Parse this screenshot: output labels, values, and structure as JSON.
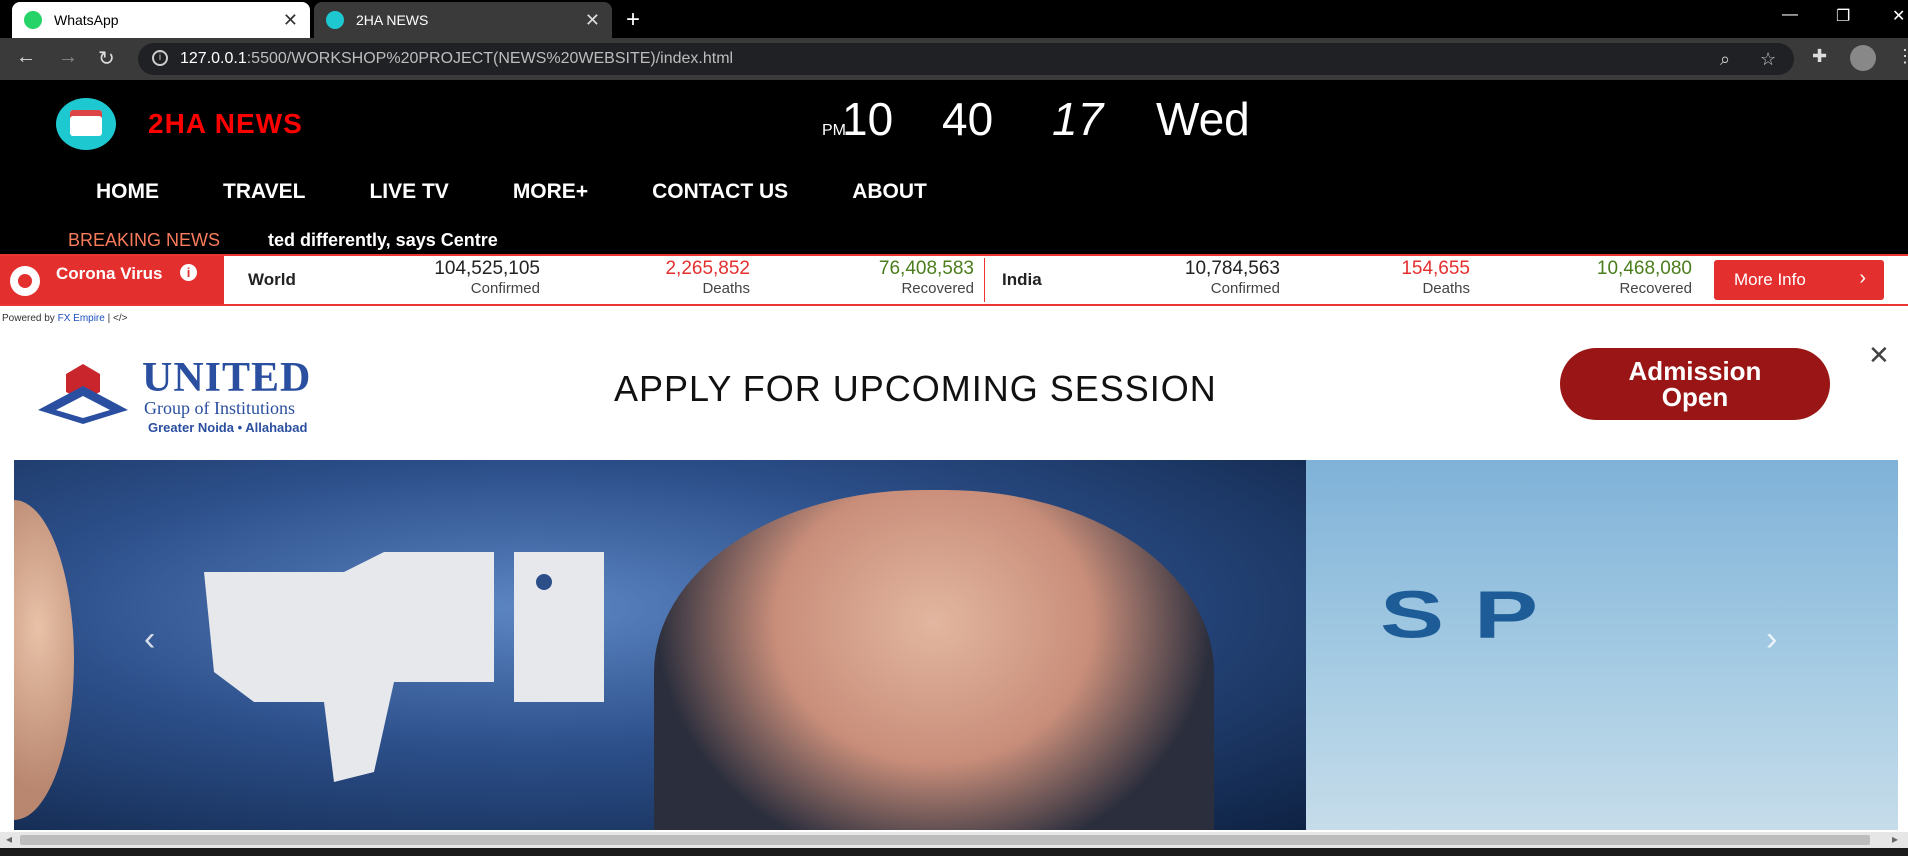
{
  "browser": {
    "tabs": [
      {
        "title": "WhatsApp",
        "icon": "whatsapp-icon"
      },
      {
        "title": "2HA NEWS",
        "icon": "news-favicon-icon"
      }
    ],
    "url_host": "127.0.0.1",
    "url_rest": ":5500/WORKSHOP%20PROJECT(NEWS%20WEBSITE)/index.html"
  },
  "site": {
    "brand": "2HA NEWS",
    "clock": {
      "ampm": "PM",
      "hour": "10",
      "minute": "40",
      "second": "17",
      "day": "Wed"
    },
    "nav": [
      "HOME",
      "TRAVEL",
      "LIVE TV",
      "MORE+",
      "CONTACT US",
      "ABOUT"
    ],
    "breaking_label": "BREAKING NEWS",
    "breaking_text": "ted differently, says Centre"
  },
  "covid": {
    "badge": "Corona Virus",
    "world": {
      "label": "World",
      "confirmed": "104,525,105",
      "deaths": "2,265,852",
      "recovered": "76,408,583"
    },
    "india": {
      "label": "India",
      "confirmed": "10,784,563",
      "deaths": "154,655",
      "recovered": "10,468,080"
    },
    "captions": {
      "confirmed": "Confirmed",
      "deaths": "Deaths",
      "recovered": "Recovered"
    },
    "more_info": "More Info",
    "powered_prefix": "Powered by",
    "powered_link": "FX Empire",
    "powered_suffix": "| </>"
  },
  "ad": {
    "united": "UNITED",
    "group": "Group of Institutions",
    "location": "Greater Noida • Allahabad",
    "headline": "APPLY FOR UPCOMING SESSION",
    "stamp_line1": "Admission",
    "stamp_line2": "Open"
  },
  "carousel": {
    "slide2_text": "SP"
  },
  "colors": {
    "brand_red": "#ff0000",
    "covid_red": "#e3302f",
    "recovered_green": "#4a7e1c",
    "breaking_orange": "#f87c5b"
  }
}
